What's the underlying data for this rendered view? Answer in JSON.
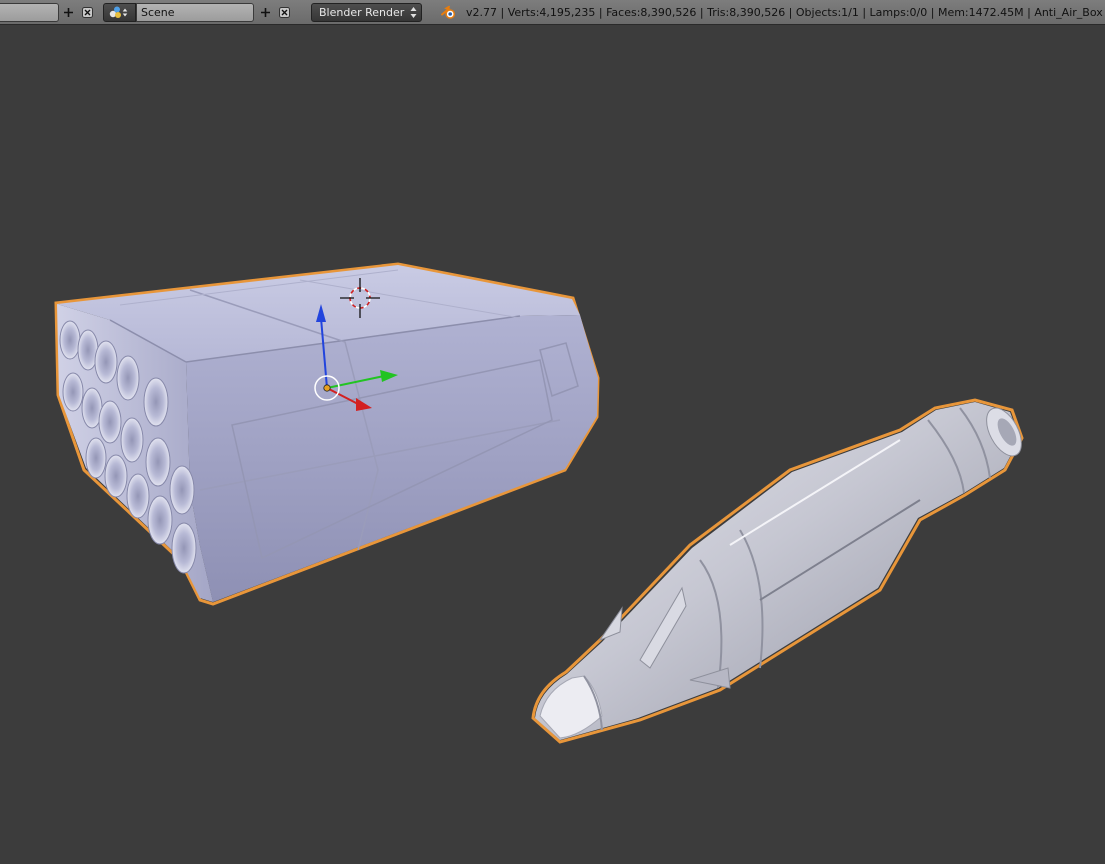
{
  "header": {
    "screen_layout_value": "",
    "scene_name": "Scene",
    "render_engine": "Blender Render",
    "stats_text": "v2.77 | Verts:4,195,235 | Faces:8,390,526 | Tris:8,390,526 | Objects:1/1 | Lamps:0/0 | Mem:1472.45M | Anti_Air_Box",
    "icons": {
      "add": "plus-icon",
      "remove": "close-x-icon",
      "scene_type": "scene-icon",
      "updown": "updown-arrows-icon",
      "app_logo": "blender-logo-icon"
    }
  },
  "viewport": {
    "background_color": "#3c3c3c",
    "objects": [
      {
        "name": "rocket-launcher-box",
        "selected": true,
        "outline_color": "#e8963a"
      },
      {
        "name": "missile",
        "selected": true,
        "outline_color": "#e8963a"
      }
    ],
    "gizmo": {
      "axis_colors": {
        "x": "#d32020",
        "y": "#22c422",
        "z": "#2244dd"
      },
      "pivot_color": "#e8a020"
    },
    "cursor_3d": {
      "ring_colors": [
        "#ffffff",
        "#d02020"
      ]
    }
  }
}
